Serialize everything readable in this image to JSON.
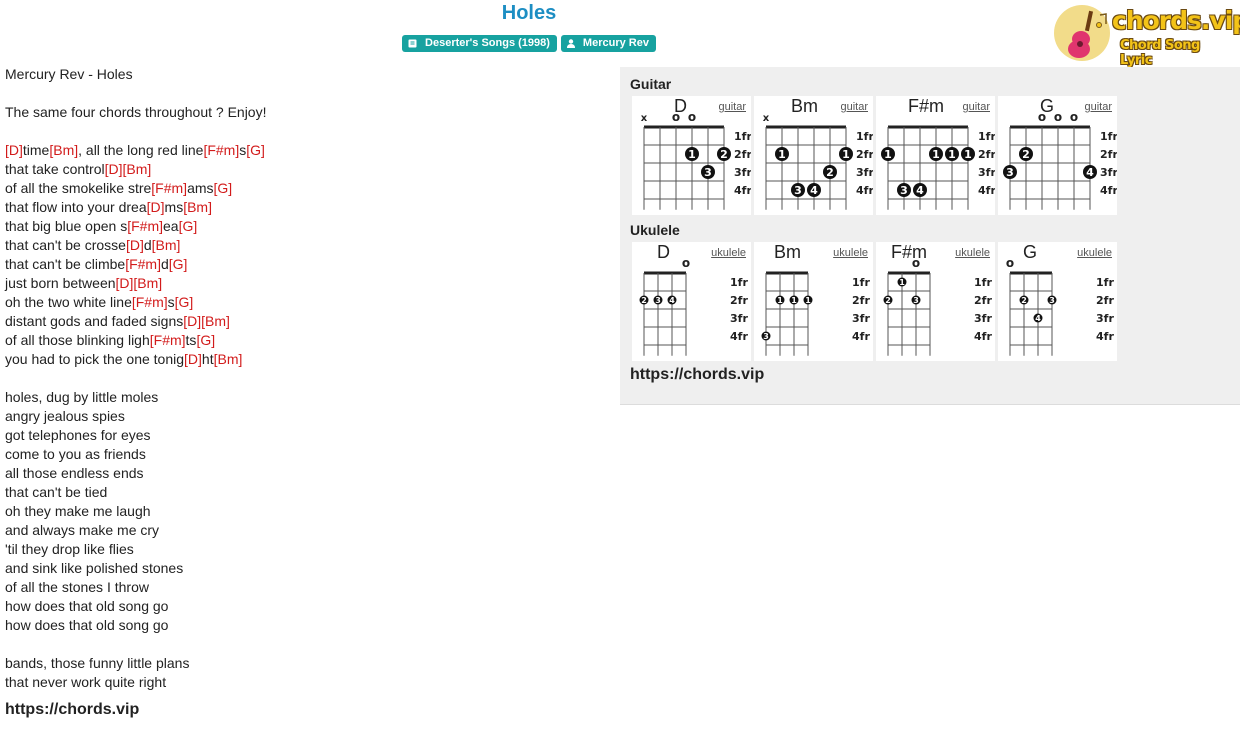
{
  "header": {
    "title": "Holes",
    "album_badge": "Deserter's Songs (1998)",
    "artist_badge": "Mercury Rev"
  },
  "logo": {
    "text": "chords.vip",
    "sub": "Chord Song Lyric"
  },
  "lyrics": {
    "lines": [
      [
        {
          "t": "Mercury Rev - Holes"
        }
      ],
      [],
      [
        {
          "t": "The same four chords throughout ? Enjoy!"
        }
      ],
      [],
      [
        {
          "c": "[D]"
        },
        {
          "t": "time"
        },
        {
          "c": "[Bm]"
        },
        {
          "t": ", all the long red line"
        },
        {
          "c": "[F#m]"
        },
        {
          "t": "s"
        },
        {
          "c": "[G]"
        }
      ],
      [
        {
          "t": "that take control"
        },
        {
          "c": "[D]"
        },
        {
          "c": "[Bm]"
        }
      ],
      [
        {
          "t": "of all the smokelike stre"
        },
        {
          "c": "[F#m]"
        },
        {
          "t": "ams"
        },
        {
          "c": "[G]"
        }
      ],
      [
        {
          "t": "that flow into your drea"
        },
        {
          "c": "[D]"
        },
        {
          "t": "ms"
        },
        {
          "c": "[Bm]"
        }
      ],
      [
        {
          "t": "that big blue open s"
        },
        {
          "c": "[F#m]"
        },
        {
          "t": "ea"
        },
        {
          "c": "[G]"
        }
      ],
      [
        {
          "t": "that can't be crosse"
        },
        {
          "c": "[D]"
        },
        {
          "t": "d"
        },
        {
          "c": "[Bm]"
        }
      ],
      [
        {
          "t": "that can't be climbe"
        },
        {
          "c": "[F#m]"
        },
        {
          "t": "d"
        },
        {
          "c": "[G]"
        }
      ],
      [
        {
          "t": "just born between"
        },
        {
          "c": "[D]"
        },
        {
          "c": "[Bm]"
        }
      ],
      [
        {
          "t": "oh the two white line"
        },
        {
          "c": "[F#m]"
        },
        {
          "t": "s"
        },
        {
          "c": "[G]"
        }
      ],
      [
        {
          "t": "distant gods and faded signs"
        },
        {
          "c": "[D]"
        },
        {
          "c": "[Bm]"
        }
      ],
      [
        {
          "t": "of all those blinking ligh"
        },
        {
          "c": "[F#m]"
        },
        {
          "t": "ts"
        },
        {
          "c": "[G]"
        }
      ],
      [
        {
          "t": "you had to pick the one tonig"
        },
        {
          "c": "[D]"
        },
        {
          "t": "ht"
        },
        {
          "c": "[Bm]"
        }
      ],
      [],
      [
        {
          "t": "holes, dug by little moles"
        }
      ],
      [
        {
          "t": "angry jealous spies"
        }
      ],
      [
        {
          "t": "got telephones for eyes"
        }
      ],
      [
        {
          "t": "come to you as friends"
        }
      ],
      [
        {
          "t": "all those endless ends"
        }
      ],
      [
        {
          "t": "that can't be tied"
        }
      ],
      [
        {
          "t": "oh they make me laugh"
        }
      ],
      [
        {
          "t": "and always make me cry"
        }
      ],
      [
        {
          "t": "'til they drop like flies"
        }
      ],
      [
        {
          "t": "and sink like polished stones"
        }
      ],
      [
        {
          "t": "of all the stones I throw"
        }
      ],
      [
        {
          "t": "how does that old song go"
        }
      ],
      [
        {
          "t": "how does that old song go"
        }
      ],
      [],
      [
        {
          "t": "bands, those funny little plans"
        }
      ],
      [
        {
          "t": "that never work quite right"
        }
      ]
    ],
    "footer_url": "https://chords.vip"
  },
  "panel": {
    "guitar_label": "Guitar",
    "ukulele_label": "Ukulele",
    "url": "https://chords.vip",
    "fret_labels": [
      "1fr",
      "2fr",
      "3fr",
      "4fr"
    ],
    "guitar": [
      {
        "name": "D",
        "link": "guitar",
        "marks": [
          "x",
          "",
          "o",
          "o",
          "",
          ""
        ],
        "dots": [
          [
            4,
            2,
            "1"
          ],
          [
            6,
            2,
            "2"
          ],
          [
            5,
            3,
            "3"
          ]
        ]
      },
      {
        "name": "Bm",
        "link": "guitar",
        "marks": [
          "x",
          "",
          "",
          "",
          "",
          ""
        ],
        "dots": [
          [
            2,
            2,
            "1"
          ],
          [
            6,
            2,
            "1"
          ],
          [
            5,
            3,
            "2"
          ],
          [
            3,
            4,
            "3"
          ],
          [
            4,
            4,
            "4"
          ]
        ]
      },
      {
        "name": "F#m",
        "link": "guitar",
        "marks": [
          "",
          "",
          "",
          "",
          "",
          ""
        ],
        "dots": [
          [
            1,
            2,
            "1"
          ],
          [
            4,
            2,
            "1"
          ],
          [
            5,
            2,
            "1"
          ],
          [
            6,
            2,
            "1"
          ],
          [
            2,
            4,
            "3"
          ],
          [
            3,
            4,
            "4"
          ]
        ]
      },
      {
        "name": "G",
        "link": "guitar",
        "marks": [
          "",
          "",
          "o",
          "o",
          "o",
          ""
        ],
        "dots": [
          [
            2,
            2,
            "2"
          ],
          [
            1,
            3,
            "3"
          ],
          [
            6,
            3,
            "4"
          ]
        ]
      }
    ],
    "ukulele": [
      {
        "name": "D",
        "link": "ukulele",
        "marks": [
          "",
          "",
          "",
          "o"
        ],
        "dots": [
          [
            1,
            2,
            "2"
          ],
          [
            2,
            2,
            "3"
          ],
          [
            3,
            2,
            "4"
          ]
        ]
      },
      {
        "name": "Bm",
        "link": "ukulele",
        "marks": [
          "",
          "",
          "",
          ""
        ],
        "dots": [
          [
            2,
            2,
            "1"
          ],
          [
            3,
            2,
            "1"
          ],
          [
            4,
            2,
            "1"
          ],
          [
            1,
            4,
            "3"
          ]
        ]
      },
      {
        "name": "F#m",
        "link": "ukulele",
        "marks": [
          "",
          "",
          "o",
          ""
        ],
        "dots": [
          [
            2,
            1,
            "1"
          ],
          [
            1,
            2,
            "2"
          ],
          [
            3,
            2,
            "3"
          ]
        ]
      },
      {
        "name": "G",
        "link": "ukulele",
        "marks": [
          "o",
          "",
          "",
          ""
        ],
        "dots": [
          [
            2,
            2,
            "2"
          ],
          [
            4,
            2,
            "3"
          ],
          [
            3,
            3,
            "4"
          ]
        ]
      }
    ]
  }
}
